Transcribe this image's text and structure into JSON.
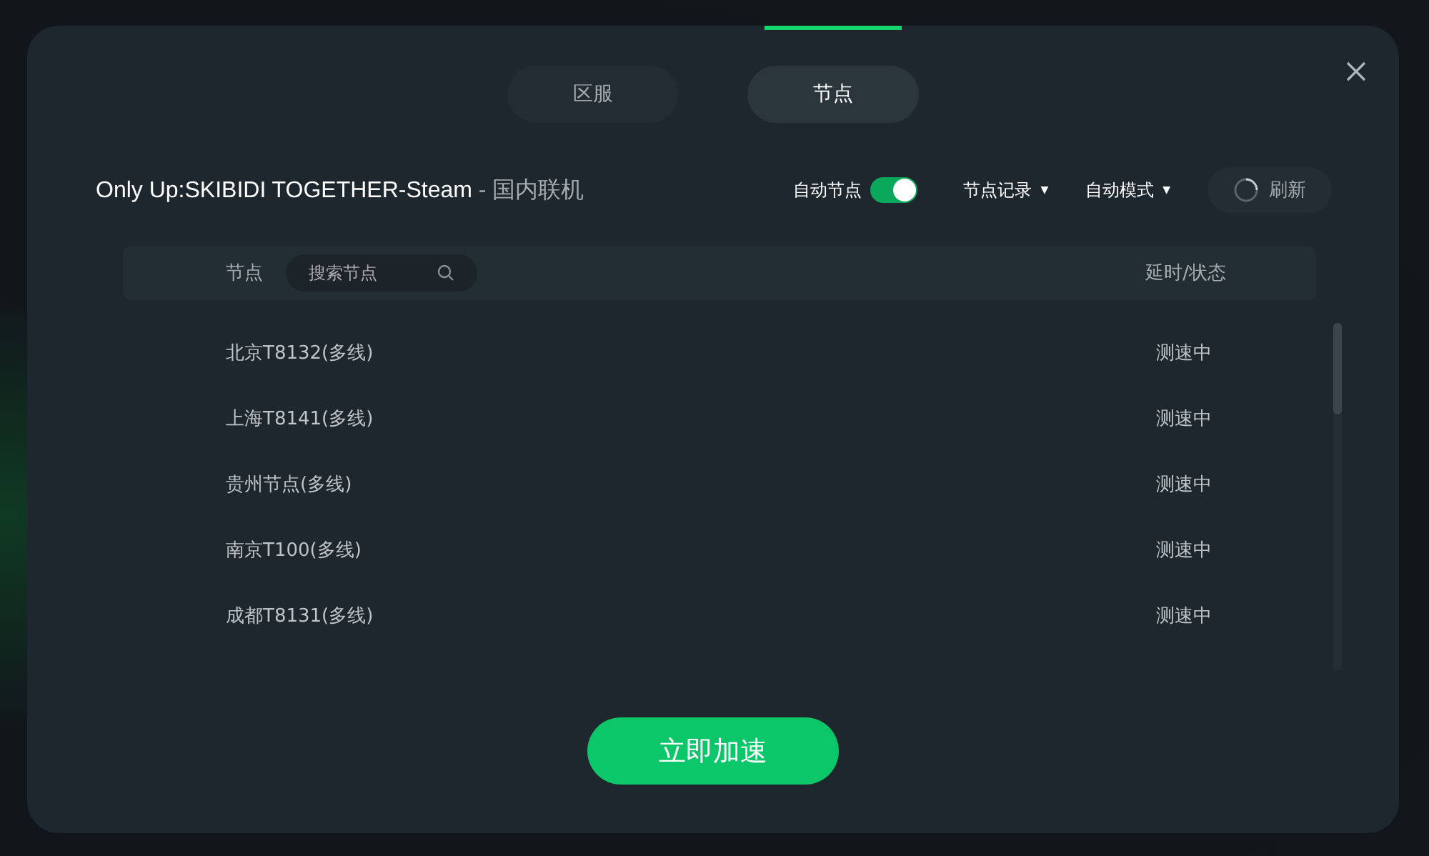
{
  "tabs": [
    {
      "label": "区服",
      "selected": false
    },
    {
      "label": "节点",
      "selected": true
    }
  ],
  "game": {
    "title": "Only Up:SKIBIDI TOGETHER-Steam",
    "separator": "-",
    "region": "国内联机"
  },
  "auto_node": {
    "label": "自动节点",
    "on": true
  },
  "dropdowns": [
    {
      "label": "节点记录",
      "caret": "▼"
    },
    {
      "label": "自动模式",
      "caret": "▼"
    }
  ],
  "refresh": {
    "label": "刷新"
  },
  "table": {
    "columns": [
      "节点",
      "延时/状态"
    ],
    "search": {
      "placeholder": "搜索节点"
    },
    "rows": [
      {
        "name": "北京T8132(多线)",
        "status": "测速中"
      },
      {
        "name": "上海T8141(多线)",
        "status": "测速中"
      },
      {
        "name": "贵州节点(多线)",
        "status": "测速中"
      },
      {
        "name": "南京T100(多线)",
        "status": "测速中"
      },
      {
        "name": "成都T8131(多线)",
        "status": "测速中"
      }
    ]
  },
  "action_button": "立即加速"
}
